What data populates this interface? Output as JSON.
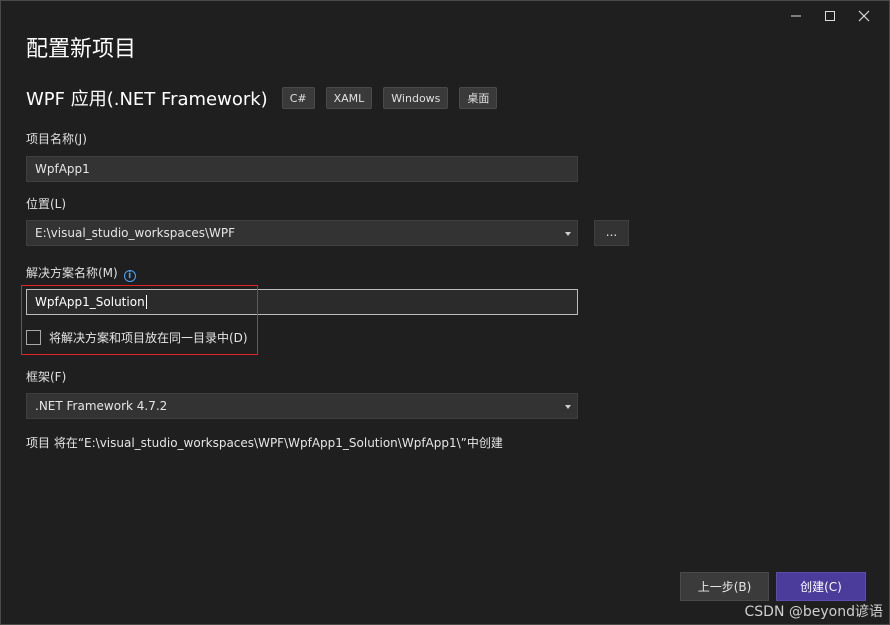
{
  "window": {
    "controls": [
      "minimize-icon",
      "maximize-icon",
      "close-icon"
    ]
  },
  "header": {
    "title": "配置新项目",
    "subtitle": "WPF 应用(.NET Framework)",
    "tags": [
      "C#",
      "XAML",
      "Windows",
      "桌面"
    ]
  },
  "project_name": {
    "label": "项目名称(J)",
    "value": "WpfApp1"
  },
  "location": {
    "label": "位置(L)",
    "value": "E:\\visual_studio_workspaces\\WPF",
    "browse_label": "..."
  },
  "solution_name": {
    "label": "解决方案名称(M)",
    "value": "WpfApp1_Solution"
  },
  "same_dir_checkbox": {
    "label": "将解决方案和项目放在同一目录中(D)",
    "checked": false
  },
  "framework": {
    "label": "框架(F)",
    "value": ".NET Framework 4.7.2"
  },
  "path_info": "项目 将在“E:\\visual_studio_workspaces\\WPF\\WpfApp1_Solution\\WpfApp1\\”中创建",
  "footer": {
    "back_label": "上一步(B)",
    "create_label": "创建(C)"
  },
  "watermark": "CSDN @beyond谚语",
  "colors": {
    "background": "#1f1f1f",
    "primary_button": "#4b3c9b",
    "highlight_border": "#e02424",
    "info_icon": "#4aa3ff"
  }
}
